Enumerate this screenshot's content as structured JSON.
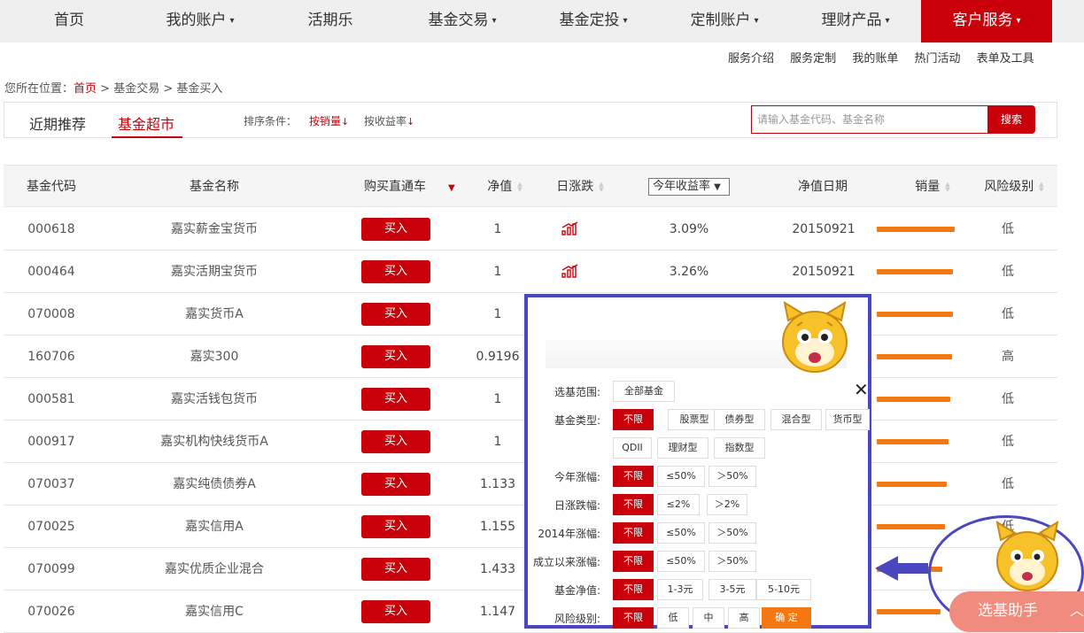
{
  "nav": {
    "items": [
      {
        "label": "首页",
        "caret": false
      },
      {
        "label": "我的账户",
        "caret": true
      },
      {
        "label": "活期乐",
        "caret": false
      },
      {
        "label": "基金交易",
        "caret": true
      },
      {
        "label": "基金定投",
        "caret": true
      },
      {
        "label": "定制账户",
        "caret": true
      },
      {
        "label": "理财产品",
        "caret": true
      },
      {
        "label": "客户服务",
        "caret": true,
        "active": true
      }
    ],
    "caret_glyph": "▾",
    "active_color": "#c9000a"
  },
  "subnav": [
    "服务介绍",
    "服务定制",
    "我的账单",
    "热门活动",
    "表单及工具"
  ],
  "breadcrumb": {
    "prefix": "您所在位置：",
    "home": "首页",
    "sep": " > ",
    "level2": "基金交易",
    "level3": "基金买入"
  },
  "tabs": [
    "近期推荐",
    "基金超市"
  ],
  "sort": {
    "label": "排序条件：",
    "options": [
      "按销量",
      "按收益率"
    ],
    "arrow": "↓"
  },
  "search": {
    "placeholder": "请输入基金代码、基金名称",
    "button": "搜索"
  },
  "table": {
    "headers": [
      "基金代码",
      "基金名称",
      "购买直通车",
      "净值",
      "日涨跌",
      "今年收益率",
      "净值日期",
      "销量",
      "风险级别"
    ],
    "select_arrow": "▼",
    "buy_label": "买入",
    "rows": [
      {
        "code": "000618",
        "name": "嘉实薪金宝货币",
        "nav": "1",
        "chart": true,
        "yield": "3.09%",
        "date": "20150921",
        "sales": 0.96,
        "risk": "低"
      },
      {
        "code": "000464",
        "name": "嘉实活期宝货币",
        "nav": "1",
        "chart": true,
        "yield": "3.26%",
        "date": "20150921",
        "sales": 0.94,
        "risk": "低"
      },
      {
        "code": "070008",
        "name": "嘉实货币A",
        "nav": "1",
        "sales": 0.93,
        "risk": "低"
      },
      {
        "code": "160706",
        "name": "嘉实300",
        "nav": "0.9196",
        "sales": 0.92,
        "risk": "高"
      },
      {
        "code": "000581",
        "name": "嘉实活钱包货币",
        "nav": "1",
        "sales": 0.9,
        "risk": "低"
      },
      {
        "code": "000917",
        "name": "嘉实机构快线货币A",
        "nav": "1",
        "sales": 0.88,
        "risk": "低"
      },
      {
        "code": "070037",
        "name": "嘉实纯债债券A",
        "nav": "1.133",
        "sales": 0.86,
        "risk": "低"
      },
      {
        "code": "070025",
        "name": "嘉实信用A",
        "nav": "1.155",
        "sales": 0.84,
        "risk": "低"
      },
      {
        "code": "070099",
        "name": "嘉实优质企业混合",
        "nav": "1.433",
        "sales": 0.8,
        "risk": "低"
      },
      {
        "code": "070026",
        "name": "嘉实信用C",
        "nav": "1.147",
        "sales": 0.78,
        "risk": "低"
      }
    ]
  },
  "popup": {
    "close": "✕",
    "filters": [
      {
        "label": "选基范围:",
        "options": [
          "全部基金"
        ],
        "selected": -1
      },
      {
        "label": "基金类型:",
        "options": [
          "不限",
          "股票型",
          "债券型",
          "混合型",
          "货币型",
          "QDII",
          "理财型",
          "指数型"
        ],
        "selected": 0
      },
      {
        "label": "今年涨幅:",
        "options": [
          "不限",
          "≤50%",
          "＞50%"
        ],
        "selected": 0
      },
      {
        "label": "日涨跌幅:",
        "options": [
          "不限",
          "≤2%",
          "＞2%"
        ],
        "selected": 0
      },
      {
        "label": "2014年涨幅:",
        "options": [
          "不限",
          "≤50%",
          "＞50%"
        ],
        "selected": 0
      },
      {
        "label": "成立以来涨幅:",
        "options": [
          "不限",
          "≤50%",
          "＞50%"
        ],
        "selected": 0
      },
      {
        "label": "基金净值:",
        "options": [
          "不限",
          "1-3元",
          "3-5元",
          "5-10元"
        ],
        "selected": 0
      },
      {
        "label": "风险级别:",
        "options": [
          "不限",
          "低",
          "中",
          "高"
        ],
        "selected": 0
      }
    ],
    "confirm": "确 定"
  },
  "helper": {
    "label": "选基助手",
    "arrow": "︿"
  },
  "colors": {
    "brand_red": "#c9000a",
    "orange": "#f47711",
    "annotation_blue": "#4a47c0"
  }
}
